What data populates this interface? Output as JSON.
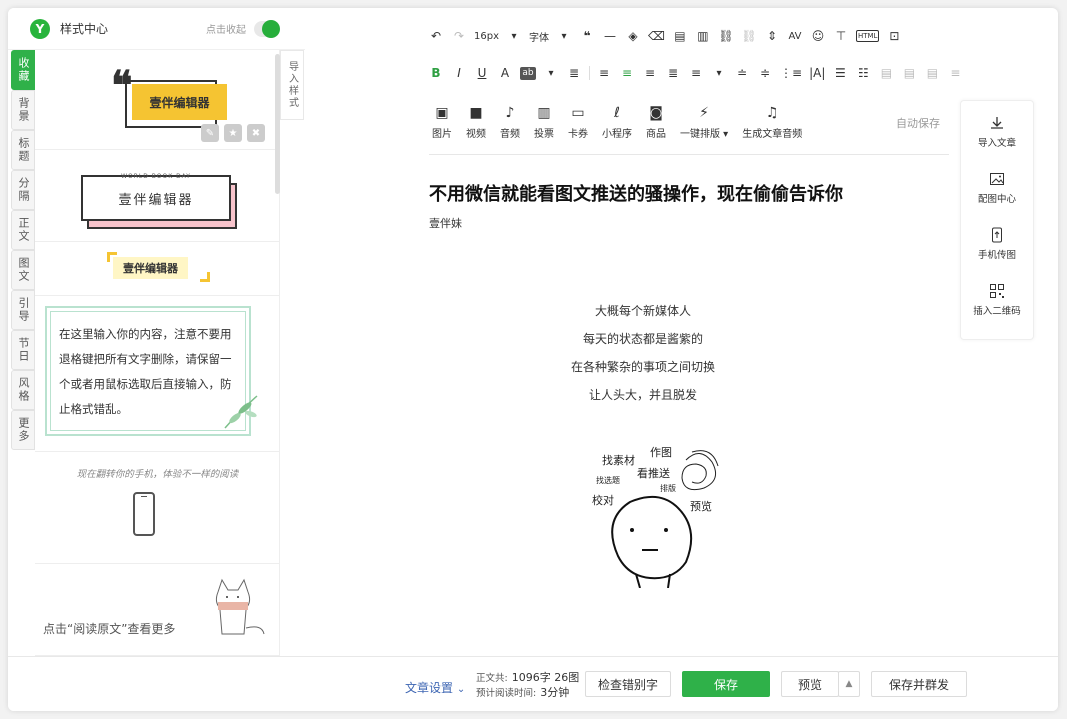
{
  "left_panel": {
    "title": "样式中心",
    "collapse_label": "点击收起",
    "tabs": [
      {
        "label": "收藏",
        "active": true
      },
      {
        "label": "背景",
        "active": false
      },
      {
        "label": "标题",
        "active": false
      },
      {
        "label": "分隔",
        "active": false
      },
      {
        "label": "正文",
        "active": false
      },
      {
        "label": "图文",
        "active": false
      },
      {
        "label": "引导",
        "active": false
      },
      {
        "label": "节日",
        "active": false
      },
      {
        "label": "风格",
        "active": false
      },
      {
        "label": "更多",
        "active": false
      }
    ],
    "import_style_label": "导入样式",
    "styles": {
      "s1_text": "壹伴编辑器",
      "s2_top": "WORLD BOOK DAY",
      "s2_text": "壹伴编辑器",
      "s3_text": "壹伴编辑器",
      "s4_text": "在这里输入你的内容，注意不要用退格键把所有文字删除，请保留一个或者用鼠标选取后直接输入，防止格式错乱。",
      "s5_text": "现在翻转你的手机，体验不一样的阅读",
      "s6_text": "点击“阅读原文”查看更多"
    },
    "accent_color": "#2fb149"
  },
  "toolbar": {
    "row1": {
      "font_size": "16px",
      "font_family": "字体",
      "glyph_undo": "↶",
      "glyph_redo": "↷",
      "glyph_quote": "❝",
      "glyph_hr": "—",
      "glyph_brush": "◈",
      "glyph_clear": "⌫",
      "glyph_doc1": "▤",
      "glyph_doc2": "▥",
      "glyph_link": "⛓",
      "glyph_unlink": "⛓",
      "glyph_lineheight": "⇕",
      "glyph_spacing": "AV",
      "glyph_emoji": "☺",
      "glyph_strike": "⊤",
      "glyph_html": "HTML",
      "glyph_case": "⊡"
    },
    "row2": {
      "bold": "B",
      "italic": "I",
      "underline": "U",
      "fontcolor": "A",
      "bgcolor": "ab"
    }
  },
  "media": [
    {
      "icon": "▣",
      "label": "图片"
    },
    {
      "icon": "■",
      "label": "视频"
    },
    {
      "icon": "♪",
      "label": "音频"
    },
    {
      "icon": "▥",
      "label": "投票"
    },
    {
      "icon": "▭",
      "label": "卡券"
    },
    {
      "icon": "ℓ",
      "label": "小程序"
    },
    {
      "icon": "◙",
      "label": "商品"
    },
    {
      "icon": "⚡",
      "label": "一键排版 ▾"
    },
    {
      "icon": "♫",
      "label": "生成文章音频"
    }
  ],
  "autosave_label": "自动保存",
  "article": {
    "title": "不用微信就能看图文推送的骚操作，现在偷偷告诉你",
    "author": "壹伴妹",
    "poem": [
      "大概每个新媒体人",
      "每天的状态都是酱紫的",
      "在各种繁杂的事项之间切换",
      "让人头大，并且脱发"
    ],
    "illustration_words": {
      "w1": "找素材",
      "w2": "作图",
      "w3": "找选题",
      "w4": "看推送",
      "w5": "排版",
      "w6": "校对",
      "w7": "预览"
    }
  },
  "right_panel": [
    {
      "label": "导入文章",
      "icon": "import-icon"
    },
    {
      "label": "配图中心",
      "icon": "image-icon"
    },
    {
      "label": "手机传图",
      "icon": "phone-upload-icon"
    },
    {
      "label": "插入二维码",
      "icon": "qrcode-icon"
    }
  ],
  "bottom": {
    "settings": "文章设置",
    "word_count_label": "正文共:",
    "word_count_value": "1096字 26图",
    "read_time_label": "预计阅读时间:",
    "read_time_value": "3分钟",
    "check_label": "检查错别字",
    "save_label": "保存",
    "preview_label": "预览",
    "save_group_label": "保存并群发"
  }
}
